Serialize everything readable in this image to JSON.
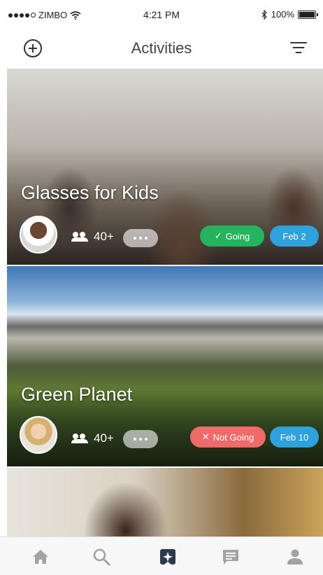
{
  "status_bar": {
    "carrier": "ZIMBO",
    "time": "4:21 PM",
    "battery": "100%"
  },
  "nav": {
    "title": "Activities",
    "left_icon": "add-circle-icon",
    "right_icon": "filter-icon"
  },
  "activities": [
    {
      "title": "Glasses for Kids",
      "attendees": "40+",
      "rsvp_label": "Going",
      "rsvp_mark": "✓",
      "rsvp_color": "#25b35e",
      "date": "Feb 2"
    },
    {
      "title": "Green Planet",
      "attendees": "40+",
      "rsvp_label": "Not Going",
      "rsvp_mark": "✕",
      "rsvp_color": "#f06a6a",
      "date": "Feb 10"
    }
  ],
  "tab_bar": {
    "active": "activities",
    "tabs": [
      "home-icon",
      "search-icon",
      "activities-icon",
      "messages-icon",
      "profile-icon"
    ]
  },
  "colors": {
    "date_pill": "#2ea2dc",
    "tab_icon": "#a3a3a3",
    "tab_active": "#2d3a4a"
  }
}
